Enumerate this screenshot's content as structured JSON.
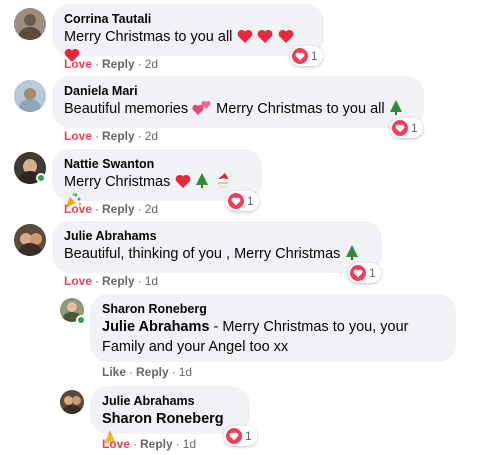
{
  "comments": [
    {
      "author": "Corrina Tautali",
      "text": "Merry Christmas to you all",
      "emojis": [
        "red-heart",
        "red-heart",
        "red-heart",
        "red-heart"
      ],
      "reaction_count": "1",
      "action_primary": "Love",
      "action_reply": "Reply",
      "time": "2d"
    },
    {
      "author": "Daniela Mari",
      "text_before": "Beautiful memories",
      "text_after": "Merry Christmas to you all",
      "emojis": [
        "two-hearts",
        "christmas-tree"
      ],
      "reaction_count": "1",
      "action_primary": "Love",
      "action_reply": "Reply",
      "time": "2d"
    },
    {
      "author": "Nattie Swanton",
      "text": "Merry Christmas",
      "emojis": [
        "red-heart",
        "christmas-tree",
        "santa",
        "party-popper"
      ],
      "reaction_count": "1",
      "action_primary": "Love",
      "action_reply": "Reply",
      "time": "2d"
    },
    {
      "author": "Julie Abrahams",
      "text": "Beautiful, thinking of you , Merry Christmas",
      "emojis": [
        "christmas-tree"
      ],
      "reaction_count": "1",
      "action_primary": "Love",
      "action_reply": "Reply",
      "time": "1d"
    }
  ],
  "replies": [
    {
      "author": "Sharon Roneberg",
      "mention": "Julie Abrahams",
      "text_line1": " - Merry Christmas to you, your",
      "text_line2": "Family and your Angel too xx",
      "action_primary": "Like",
      "action_reply": "Reply",
      "time": "1d"
    },
    {
      "author": "Julie Abrahams",
      "mention": "Sharon Roneberg",
      "emojis": [
        "folded-hands"
      ],
      "reaction_count": "1",
      "action_primary": "Love",
      "action_reply": "Reply",
      "time": "1d"
    }
  ],
  "separator": "·",
  "colors": {
    "love": "#f33e58",
    "bubble": "#f0f2f5",
    "meta": "#65676b",
    "online": "#31a24c"
  }
}
